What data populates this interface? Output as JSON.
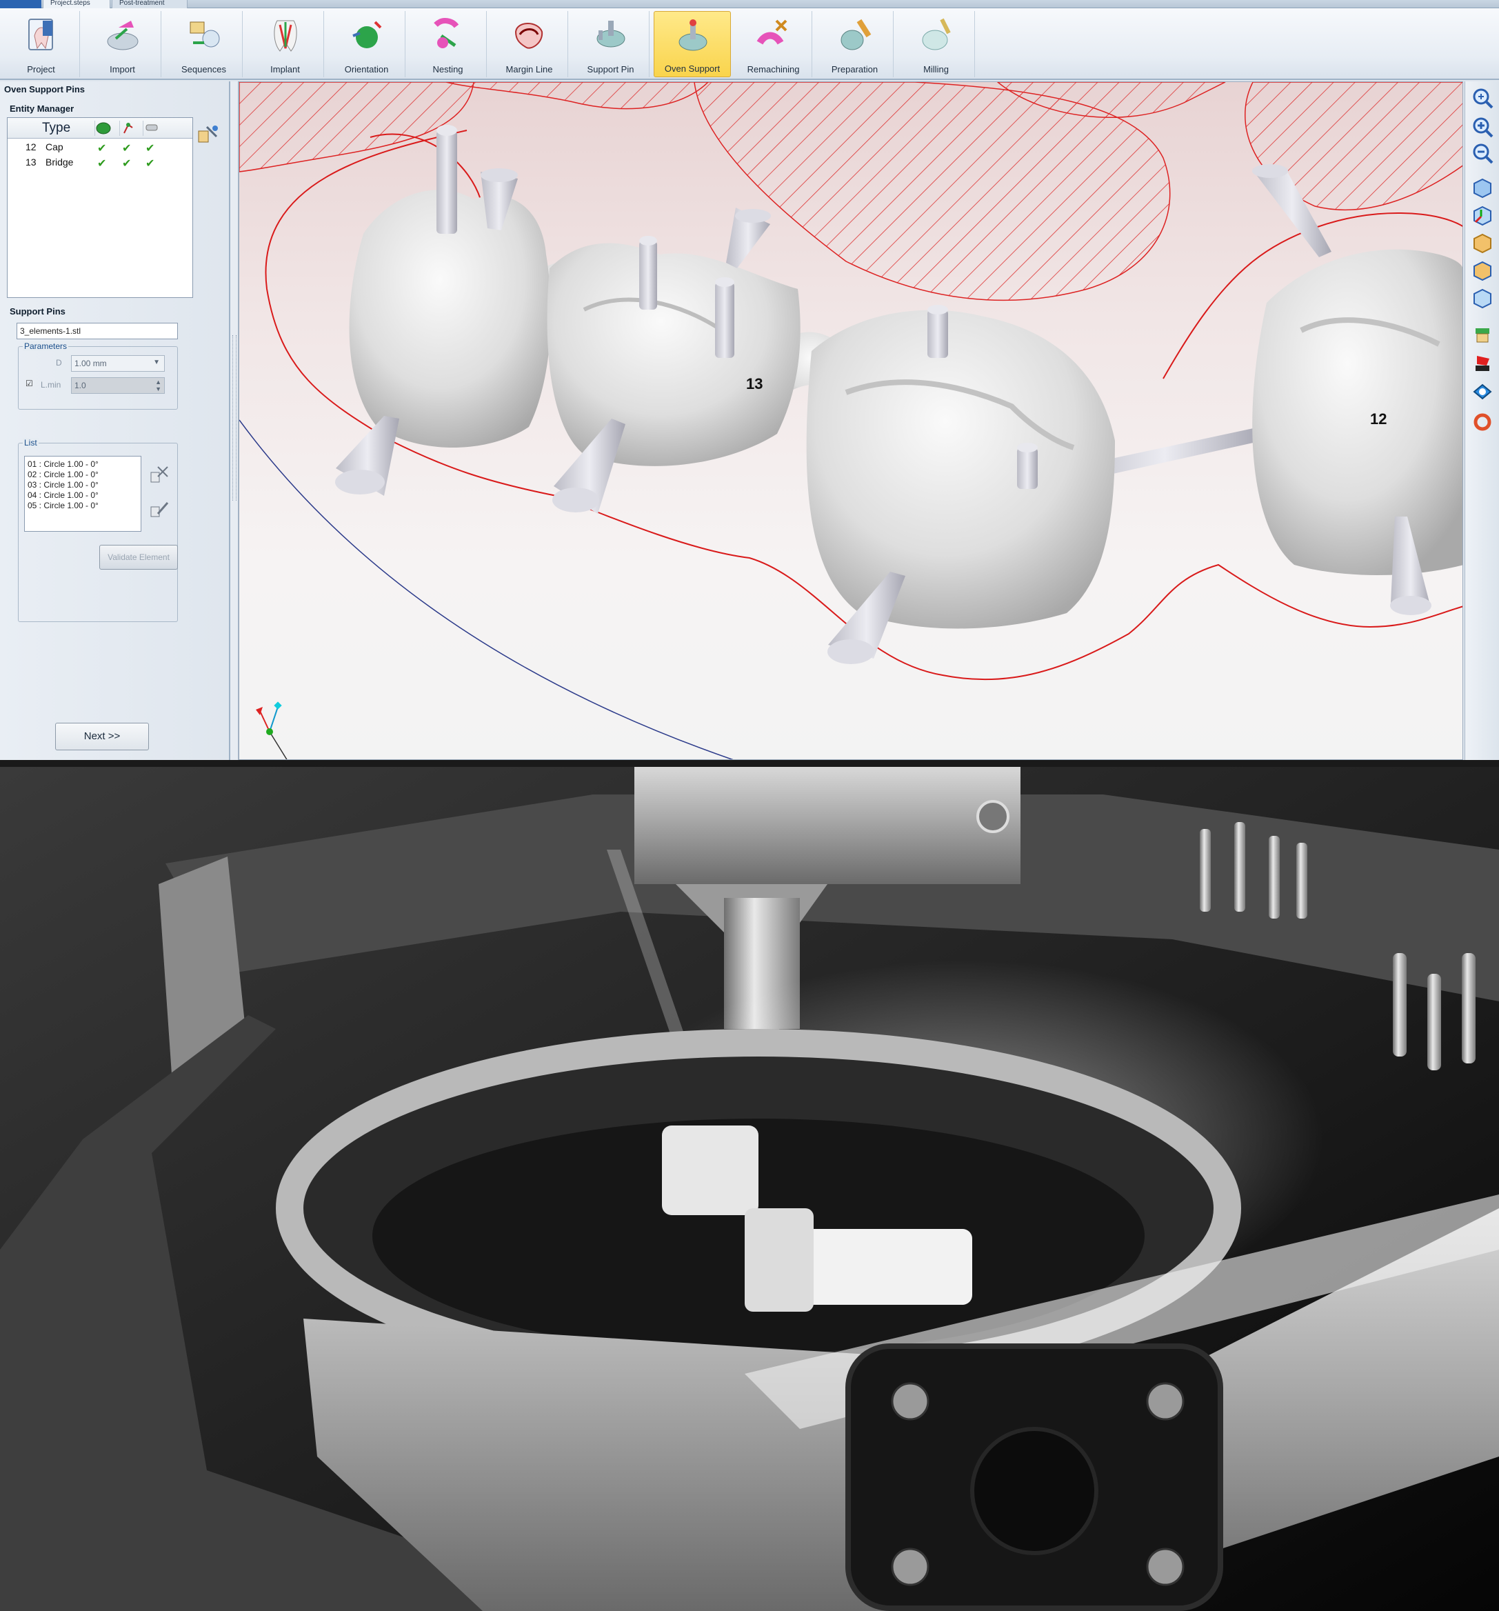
{
  "tabs": {
    "steps": "Project.steps",
    "post": "Post-treatment"
  },
  "ribbon": [
    {
      "id": "project",
      "label": "Project",
      "icon": "project-icon"
    },
    {
      "id": "import",
      "label": "Import",
      "icon": "import-icon"
    },
    {
      "id": "sequences",
      "label": "Sequences",
      "icon": "sequences-icon"
    },
    {
      "id": "implant",
      "label": "Implant",
      "icon": "implant-icon"
    },
    {
      "id": "orientation",
      "label": "Orientation",
      "icon": "orientation-icon"
    },
    {
      "id": "nesting",
      "label": "Nesting",
      "icon": "nesting-icon"
    },
    {
      "id": "margin-line",
      "label": "Margin Line",
      "icon": "margin-line-icon"
    },
    {
      "id": "support-pin",
      "label": "Support Pin",
      "icon": "support-pin-icon"
    },
    {
      "id": "oven-support",
      "label": "Oven Support",
      "icon": "oven-support-icon",
      "active": true
    },
    {
      "id": "remachining",
      "label": "Remachining",
      "icon": "remachining-icon"
    },
    {
      "id": "preparation",
      "label": "Preparation",
      "icon": "preparation-icon"
    },
    {
      "id": "milling",
      "label": "Milling",
      "icon": "milling-icon"
    }
  ],
  "panel": {
    "title": "Oven Support Pins",
    "entity_manager": {
      "title": "Entity Manager",
      "col_type": "Type",
      "rows": [
        {
          "id": "12",
          "name": "Cap"
        },
        {
          "id": "13",
          "name": "Bridge"
        }
      ]
    },
    "support_pins": {
      "title": "Support Pins",
      "file": "3_elements-1.stl",
      "parameters_legend": "Parameters",
      "d_label": "D",
      "d_value": "1.00 mm",
      "lmin_label": "L.min",
      "lmin_value": "1.0",
      "list_legend": "List",
      "list": [
        "01 : Circle 1.00 - 0°",
        "02 : Circle 1.00 - 0°",
        "03 : Circle 1.00 - 0°",
        "04 : Circle 1.00 - 0°",
        "05 : Circle 1.00 - 0°"
      ],
      "validate": "Validate Element"
    },
    "next": "Next >>"
  },
  "viewport": {
    "labels": {
      "bridge": "13",
      "cap": "12"
    }
  },
  "colors": {
    "accent_active": "#f9d44c",
    "margin_line": "#d91a1a",
    "model": "#e6e6e6"
  },
  "right_tools": [
    "zoom-window-icon",
    "zoom-in-icon",
    "zoom-out-icon",
    "view-iso-icon",
    "view-axes-icon",
    "view-front-icon",
    "view-side-icon",
    "view-top-icon",
    "clip-icon",
    "flag-icon",
    "shape-icon",
    "ring-icon"
  ]
}
